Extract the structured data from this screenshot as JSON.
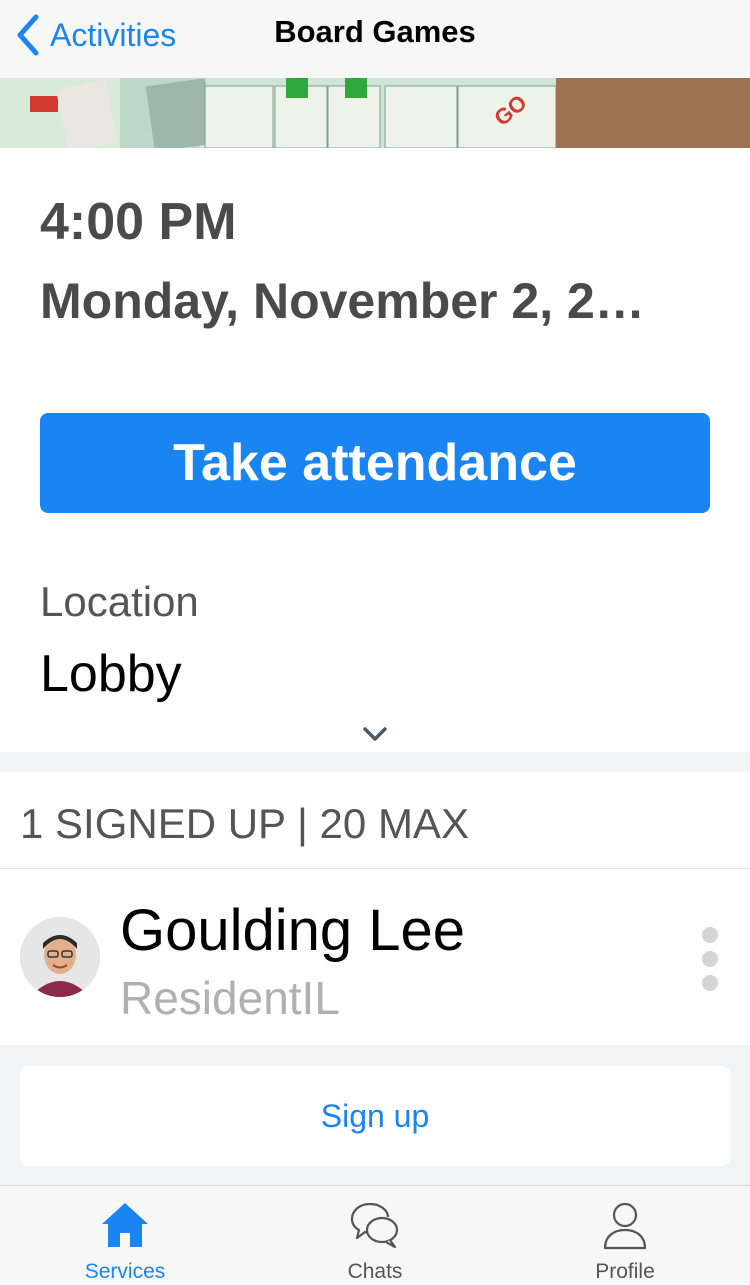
{
  "navbar": {
    "back_label": "Activities",
    "title": "Board Games"
  },
  "event": {
    "time": "4:00 PM",
    "date": "Monday, November 2, 2…",
    "attendance_button": "Take attendance",
    "location_label": "Location",
    "location_value": "Lobby"
  },
  "signups": {
    "summary": "1 SIGNED UP | 20 MAX",
    "attendees": [
      {
        "name": "Goulding Lee",
        "role": "ResidentIL"
      }
    ],
    "signup_button": "Sign up"
  },
  "tabbar": {
    "tabs": [
      {
        "label": "Services",
        "icon": "house-icon",
        "active": true
      },
      {
        "label": "Chats",
        "icon": "chat-bubbles-icon",
        "active": false
      },
      {
        "label": "Profile",
        "icon": "person-icon",
        "active": false
      }
    ]
  },
  "colors": {
    "accent": "#1a84f2",
    "primary_text": "#4a4a4a",
    "secondary_text": "#b0b0b0",
    "separator": "#f2f3f5"
  }
}
